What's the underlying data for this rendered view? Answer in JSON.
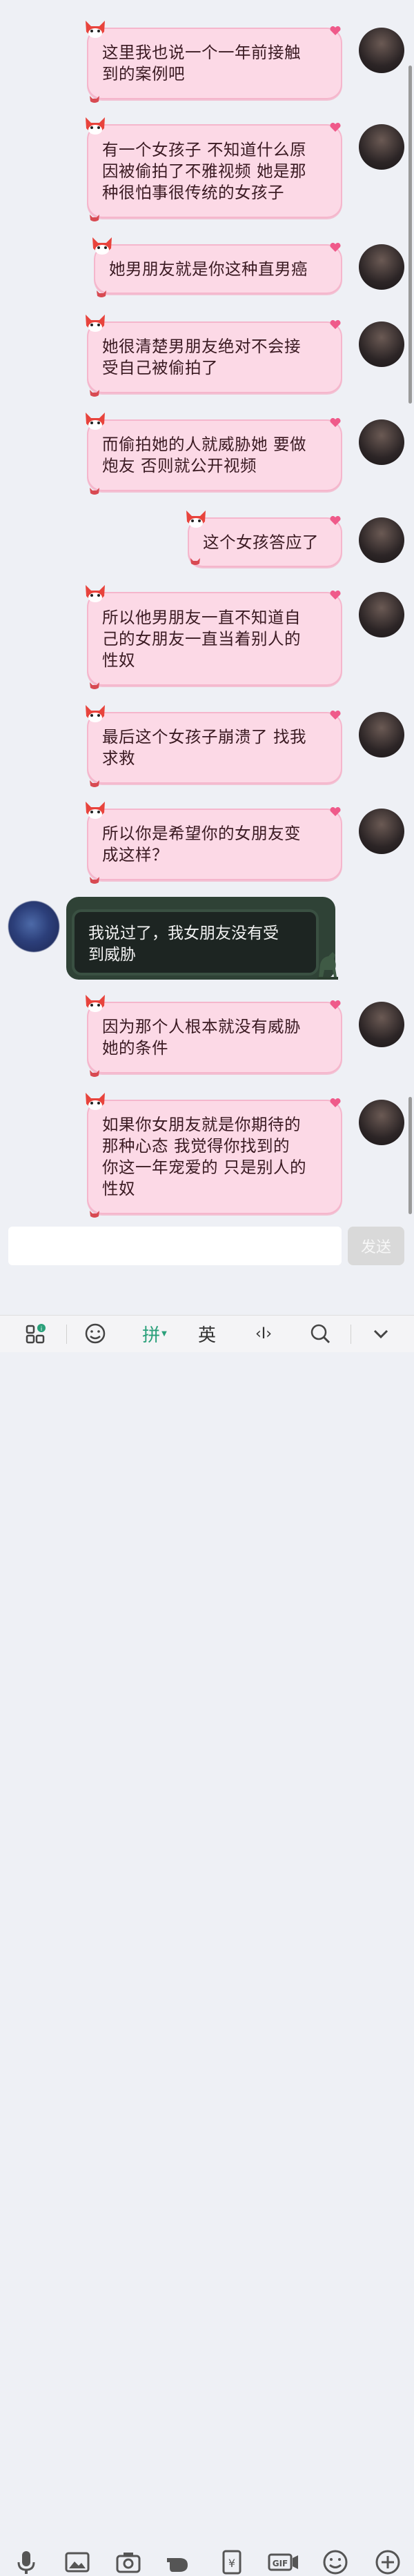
{
  "colors": {
    "bubble_bg": "#fcd9e6",
    "bubble_border": "#f5b6cc",
    "dark_bubble_bg": "#1d2522",
    "accent_green": "#2aa07a"
  },
  "messages": [
    {
      "side": "right",
      "text": "这里我也说一个一年前接触\n到的案例吧"
    },
    {
      "side": "right",
      "text": "有一个女孩子 不知道什么原\n因被偷拍了不雅视频 她是那\n种很怕事很传统的女孩子"
    },
    {
      "side": "right",
      "text": "她男朋友就是你这种直男癌"
    },
    {
      "side": "right",
      "text": "她很清楚男朋友绝对不会接\n受自己被偷拍了"
    },
    {
      "side": "right",
      "text": "而偷拍她的人就威胁她 要做\n炮友 否则就公开视频"
    },
    {
      "side": "right",
      "text": "这个女孩答应了"
    },
    {
      "side": "right",
      "text": "所以他男朋友一直不知道自\n己的女朋友一直当着别人的\n性奴"
    },
    {
      "side": "right",
      "text": "最后这个女孩子崩溃了 找我\n求救"
    },
    {
      "side": "right",
      "text": "所以你是希望你的女朋友变\n成这样？"
    },
    {
      "side": "left",
      "text": "我说过了，我女朋友没有受\n到威胁"
    },
    {
      "side": "right",
      "text": "因为那个人根本就没有威胁\n她的条件"
    },
    {
      "side": "right",
      "text": "如果你女朋友就是你期待的\n那种心态 我觉得你找到的\n你这一年宠爱的 只是别人的\n性奴"
    }
  ],
  "input": {
    "value": "",
    "send_label": "发送"
  },
  "toolbar": {
    "icons": [
      "microphone-icon",
      "image-icon",
      "camera-icon",
      "finger-icon",
      "red-packet-icon",
      "gif-icon",
      "emoji-icon",
      "plus-icon"
    ],
    "gif_label": "GIF"
  },
  "keyboard_bar": {
    "grid_badge": "i",
    "pinyin_label": "拼",
    "english_label": "英",
    "cursor_label": "‹I›"
  }
}
